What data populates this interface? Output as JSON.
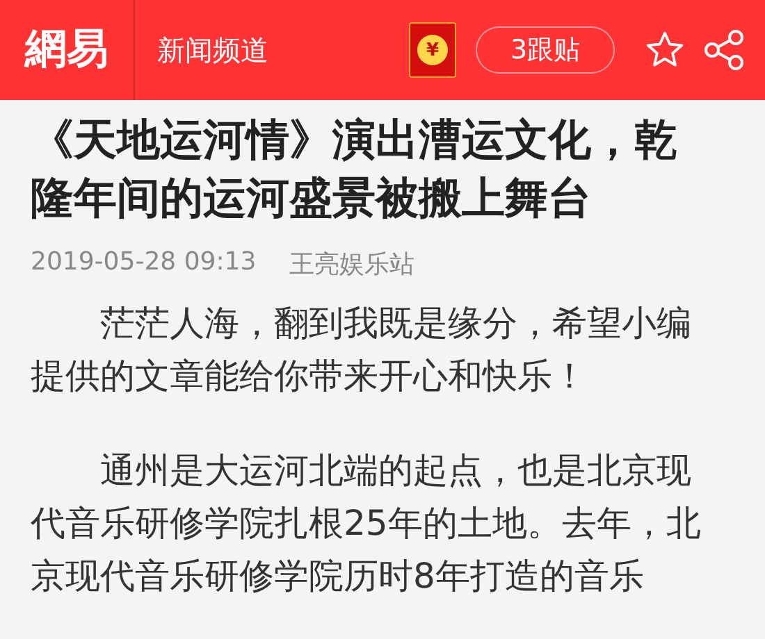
{
  "header": {
    "logo": "網易",
    "channel": "新闻频道",
    "red_packet_symbol": "¥",
    "comments_button": "3跟贴"
  },
  "article": {
    "title": "《天地运河情》演出漕运文化，乾隆年间的运河盛景被搬上舞台",
    "date": "2019-05-28 09:13",
    "source": "王亮娱乐站",
    "paragraphs": [
      "茫茫人海，翻到我既是缘分，希望小编提供的文章能给你带来开心和快乐！",
      "通州是大运河北端的起点，也是北京现代音乐研修学院扎根25年的土地。去年，北京现代音乐研修学院历时8年打造的音乐"
    ]
  }
}
